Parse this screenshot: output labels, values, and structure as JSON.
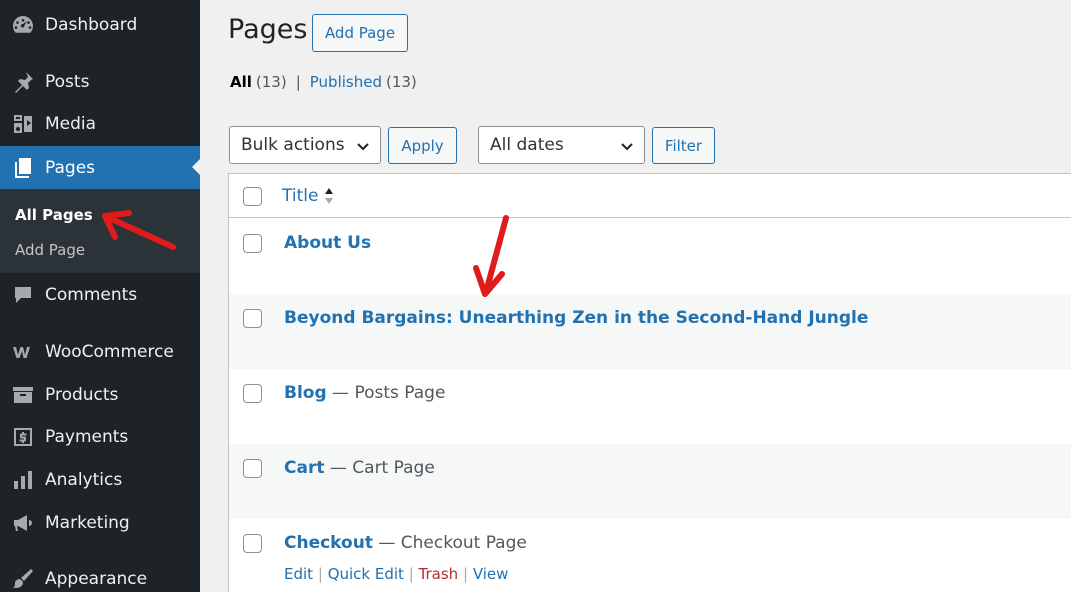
{
  "sidebar": {
    "items": [
      {
        "name": "dashboard",
        "label": "Dashboard",
        "icon": "dashboard-icon"
      },
      {
        "name": "posts",
        "label": "Posts",
        "icon": "pin-icon"
      },
      {
        "name": "media",
        "label": "Media",
        "icon": "media-icon"
      },
      {
        "name": "pages",
        "label": "Pages",
        "icon": "pages-icon"
      },
      {
        "name": "comments",
        "label": "Comments",
        "icon": "comment-icon"
      },
      {
        "name": "woocommerce",
        "label": "WooCommerce",
        "icon": "woocommerce-icon"
      },
      {
        "name": "products",
        "label": "Products",
        "icon": "archive-icon"
      },
      {
        "name": "payments",
        "label": "Payments",
        "icon": "dollar-icon"
      },
      {
        "name": "analytics",
        "label": "Analytics",
        "icon": "bar-chart-icon"
      },
      {
        "name": "marketing",
        "label": "Marketing",
        "icon": "megaphone-icon"
      },
      {
        "name": "appearance",
        "label": "Appearance",
        "icon": "brush-icon"
      }
    ],
    "submenu": {
      "all_pages": "All Pages",
      "add_page": "Add Page"
    }
  },
  "header": {
    "title": "Pages",
    "add_page_button": "Add Page"
  },
  "views": {
    "all_label": "All",
    "all_count": "(13)",
    "separator": "|",
    "published_label": "Published",
    "published_count": "(13)"
  },
  "filters": {
    "bulk_actions": "Bulk actions",
    "apply": "Apply",
    "dates": "All dates",
    "filter": "Filter"
  },
  "table": {
    "title_header": "Title",
    "rows": [
      {
        "title": "About Us",
        "state": ""
      },
      {
        "title": "Beyond Bargains: Unearthing Zen in the Second-Hand Jungle",
        "state": ""
      },
      {
        "title": "Blog",
        "state": " — Posts Page"
      },
      {
        "title": "Cart",
        "state": " — Cart Page"
      },
      {
        "title": "Checkout",
        "state": " — Checkout Page"
      }
    ],
    "row_actions": {
      "edit": "Edit",
      "quick_edit": "Quick Edit",
      "trash": "Trash",
      "view": "View",
      "sep": "|"
    }
  },
  "colors": {
    "sidebar_bg": "#1d2327",
    "accent": "#2271b1",
    "annotation_arrow": "#e01b1b",
    "trash": "#b32d2e"
  }
}
